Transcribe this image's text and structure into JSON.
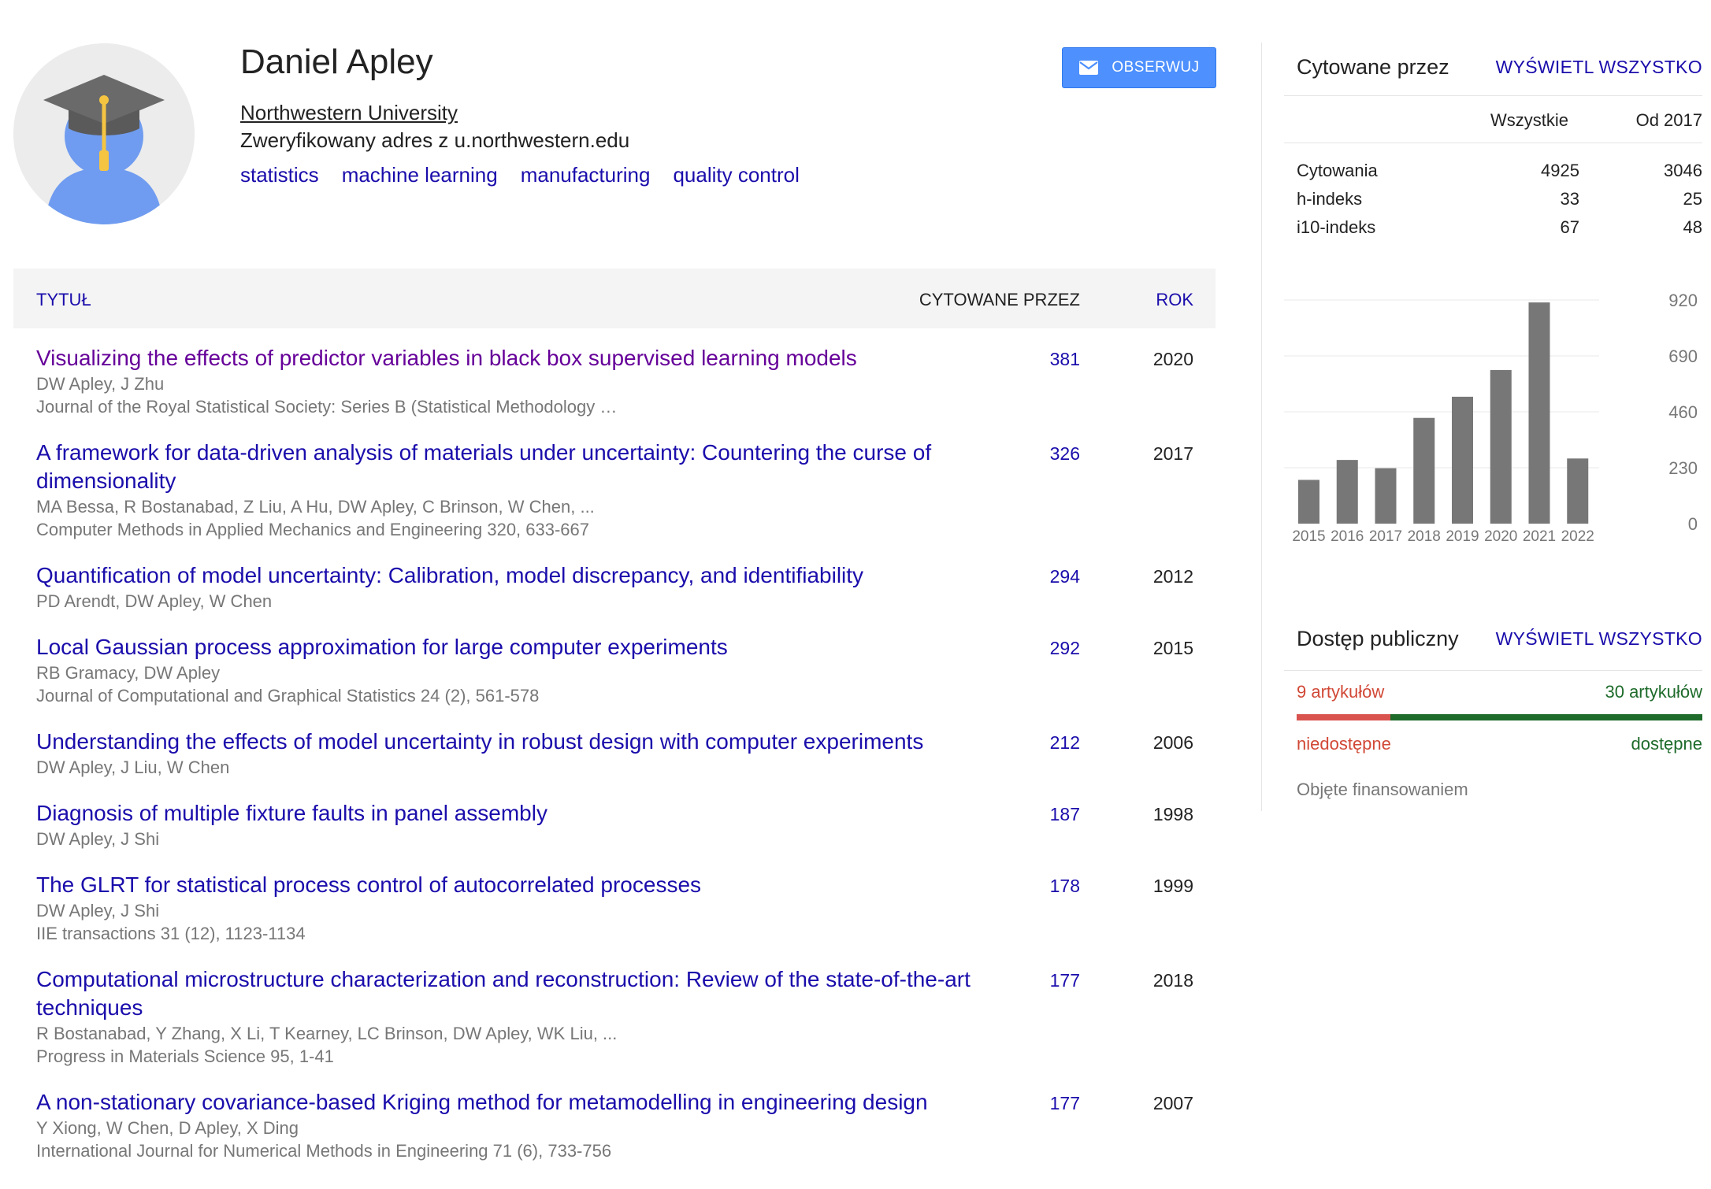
{
  "profile": {
    "name": "Daniel Apley",
    "affiliation": "Northwestern University",
    "email_verified": "Zweryfikowany adres z u.northwestern.edu",
    "interests": [
      "statistics",
      "machine learning",
      "manufacturing",
      "quality control"
    ],
    "follow_label": "OBSERWUJ",
    "follow_icon": "envelope-icon",
    "accent_color": "#4d90fe"
  },
  "table": {
    "col_title": "TYTUŁ",
    "col_cited": "CYTOWANE PRZEZ",
    "col_year": "ROK",
    "rows": [
      {
        "title": "Visualizing the effects of predictor variables in black box supervised learning models",
        "authors": "DW Apley, J Zhu",
        "venue": "Journal of the Royal Statistical Society: Series B (Statistical Methodology …",
        "cites": "381",
        "year": "2020",
        "visited": true
      },
      {
        "title": "A framework for data-driven analysis of materials under uncertainty: Countering the curse of dimensionality",
        "authors": "MA Bessa, R Bostanabad, Z Liu, A Hu, DW Apley, C Brinson, W Chen, ...",
        "venue": "Computer Methods in Applied Mechanics and Engineering 320, 633-667",
        "cites": "326",
        "year": "2017",
        "visited": false
      },
      {
        "title": "Quantification of model uncertainty: Calibration, model discrepancy, and identifiability",
        "authors": "PD Arendt, DW Apley, W Chen",
        "venue": "",
        "cites": "294",
        "year": "2012",
        "visited": false
      },
      {
        "title": "Local Gaussian process approximation for large computer experiments",
        "authors": "RB Gramacy, DW Apley",
        "venue": "Journal of Computational and Graphical Statistics 24 (2), 561-578",
        "cites": "292",
        "year": "2015",
        "visited": false
      },
      {
        "title": "Understanding the effects of model uncertainty in robust design with computer experiments",
        "authors": "DW Apley, J Liu, W Chen",
        "venue": "",
        "cites": "212",
        "year": "2006",
        "visited": false
      },
      {
        "title": "Diagnosis of multiple fixture faults in panel assembly",
        "authors": "DW Apley, J Shi",
        "venue": "",
        "cites": "187",
        "year": "1998",
        "visited": false
      },
      {
        "title": "The GLRT for statistical process control of autocorrelated processes",
        "authors": "DW Apley, J Shi",
        "venue": "IIE transactions 31 (12), 1123-1134",
        "cites": "178",
        "year": "1999",
        "visited": false
      },
      {
        "title": "Computational microstructure characterization and reconstruction: Review of the state-of-the-art techniques",
        "authors": "R Bostanabad, Y Zhang, X Li, T Kearney, LC Brinson, DW Apley, WK Liu, ...",
        "venue": "Progress in Materials Science 95, 1-41",
        "cites": "177",
        "year": "2018",
        "visited": false
      },
      {
        "title": "A non-stationary covariance-based Kriging method for metamodelling in engineering design",
        "authors": "Y Xiong, W Chen, D Apley, X Ding",
        "venue": "International Journal for Numerical Methods in Engineering 71 (6), 733-756",
        "cites": "177",
        "year": "2007",
        "visited": false
      }
    ]
  },
  "cited_by": {
    "title": "Cytowane przez",
    "view_all": "WYŚWIETL WSZYSTKO",
    "col_all": "Wszystkie",
    "col_since": "Od 2017",
    "stats": [
      {
        "label": "Cytowania",
        "all": "4925",
        "since": "3046"
      },
      {
        "label": "h-indeks",
        "all": "33",
        "since": "25"
      },
      {
        "label": "i10-indeks",
        "all": "67",
        "since": "48"
      }
    ]
  },
  "chart_data": {
    "type": "bar",
    "categories": [
      "2015",
      "2016",
      "2017",
      "2018",
      "2019",
      "2020",
      "2021",
      "2022"
    ],
    "values": [
      180,
      262,
      228,
      435,
      522,
      632,
      910,
      268
    ],
    "y_ticks": [
      "920",
      "690",
      "460",
      "230",
      "0"
    ],
    "ylim": [
      0,
      920
    ],
    "grid": true,
    "bar_color": "#777777"
  },
  "open_access": {
    "title": "Dostęp publiczny",
    "view_all": "WYŚWIETL WSZYSTKO",
    "unavailable_count": "9 artykułów",
    "available_count": "30 artykułów",
    "unavailable_n": 9,
    "available_n": 30,
    "unavailable_label": "niedostępne",
    "available_label": "dostępne",
    "funded_label": "Objęte finansowaniem",
    "unavailable_color": "#d9534f",
    "available_color": "#1e6b2b"
  }
}
